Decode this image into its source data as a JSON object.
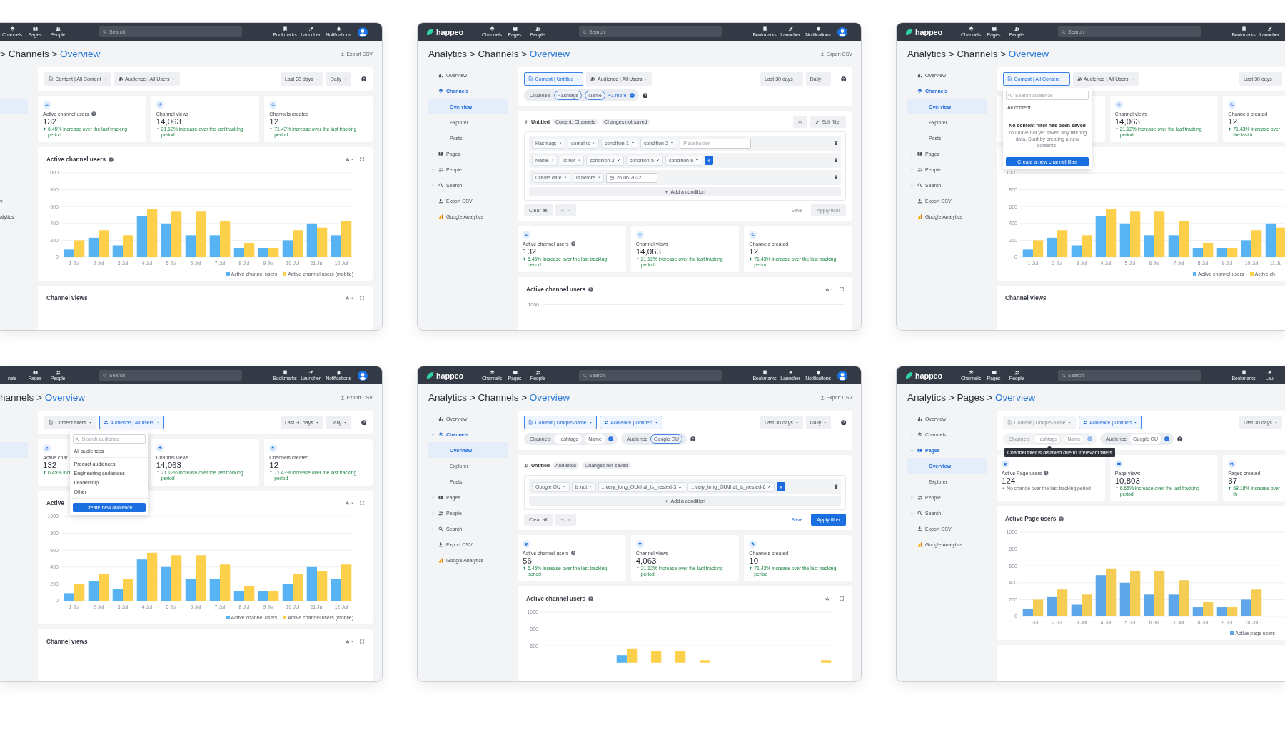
{
  "windows": [
    {
      "topbar": {
        "nav": [
          {
            "kind": "channels",
            "label": "Channels"
          },
          {
            "kind": "pages",
            "label": "Pages"
          },
          {
            "kind": "people",
            "label": "People"
          }
        ],
        "search": {
          "placeholder": "Search"
        },
        "actions": [
          {
            "kind": "bookmarks",
            "label": "Bookmarks"
          },
          {
            "kind": "launcher",
            "label": "Launcher"
          },
          {
            "kind": "notifications",
            "label": "Notifications"
          }
        ],
        "avatar": true
      },
      "breadcrumb": {
        "path": "> Channels > ",
        "current": "Overview"
      },
      "export": "Export CSV",
      "sidebar": {
        "kind": "fragment",
        "selected": true,
        "texts": [
          "y",
          "alytics"
        ]
      },
      "filters": {
        "buttons": [
          {
            "kind": "content",
            "label": "Content | All Content",
            "active": false
          },
          {
            "kind": "audience",
            "label": "Audience | All Users",
            "active": false
          }
        ],
        "period": "Last 30 days",
        "interval": "Daily",
        "help": true
      },
      "stats": [
        {
          "kind": "users",
          "label": "Active channel users",
          "help": true,
          "value": "132",
          "change": "6.45% increase over the last tracking period",
          "up": true
        },
        {
          "kind": "views",
          "label": "Channel views",
          "value": "14,063",
          "change": "21.12% increase over the last tracking period",
          "up": true
        },
        {
          "kind": "created",
          "label": "Channels created",
          "value": "12",
          "change": "71.43% increase over the last tracking period",
          "up": true
        }
      ],
      "charts": [
        {
          "title": "Active channel users",
          "help": true,
          "tools": true,
          "chart_data": {
            "type": "bar",
            "grid": true,
            "legend": "bottom-right",
            "categories": [
              "1 Jul",
              "2 Jul",
              "3 Jul",
              "4 Jul",
              "5 Jul",
              "6 Jul",
              "7 Jul",
              "8 Jul",
              "9 Jul",
              "10 Jul",
              "11 Jul",
              "12 Jul"
            ],
            "ylim": [
              0,
              1000
            ],
            "yticks": [
              0,
              200,
              400,
              600,
              800,
              1000
            ],
            "series": [
              {
                "name": "Active channel users",
                "color": "#57b3f2",
                "values": [
                  90,
                  230,
                  140,
                  490,
                  400,
                  260,
                  260,
                  110,
                  110,
                  200,
                  400,
                  260
                ]
              },
              {
                "name": "Active channel users (mobile)",
                "color": "#fdd04c",
                "values": [
                  200,
                  320,
                  260,
                  570,
                  540,
                  540,
                  430,
                  170,
                  110,
                  320,
                  350,
                  430
                ]
              }
            ]
          }
        },
        {
          "title": "Channel views",
          "tools": true
        }
      ]
    },
    {
      "topbar": {
        "logo": "happeo",
        "nav": [
          {
            "kind": "channels",
            "label": "Channels"
          },
          {
            "kind": "pages",
            "label": "Pages"
          },
          {
            "kind": "people",
            "label": "People"
          }
        ],
        "search": {
          "placeholder": "Search"
        },
        "actions": [
          {
            "kind": "bookmarks",
            "label": "Bookmarks"
          },
          {
            "kind": "launcher",
            "label": "Launcher"
          },
          {
            "kind": "notifications",
            "label": "Notifications"
          }
        ],
        "avatar": true
      },
      "breadcrumb": {
        "path": "Analytics > Channels > ",
        "current": "Overview"
      },
      "export": "Export CSV",
      "sidebar": {
        "kind": "tree",
        "items": [
          {
            "kind": "overview",
            "label": "Overview",
            "selected": false
          },
          {
            "kind": "channels",
            "label": "Channels",
            "selected": false,
            "expanded": true,
            "children": [
              {
                "label": "Overview",
                "selected": true
              },
              {
                "label": "Explorer",
                "selected": false
              },
              {
                "label": "Posts",
                "selected": false
              }
            ]
          },
          {
            "kind": "pages",
            "label": "Pages",
            "selected": false,
            "expanded": false
          },
          {
            "kind": "people",
            "label": "People",
            "selected": false,
            "expanded": false
          },
          {
            "kind": "search",
            "label": "Search",
            "selected": false,
            "expanded": false
          },
          {
            "kind": "export",
            "label": "Export CSV",
            "selected": false
          },
          {
            "kind": "analytics",
            "label": "Google Analytics",
            "selected": false
          }
        ]
      },
      "filters": {
        "buttons": [
          {
            "kind": "content",
            "label": "Content | Untitled",
            "active": true
          },
          {
            "kind": "audience",
            "label": "Audience | All Users",
            "active": false
          }
        ],
        "period": "Last 30 days",
        "interval": "Daily",
        "help": true,
        "chip_groups": [
          {
            "label": "Channels",
            "chips": [
              {
                "label": "Hashtags",
                "selected": true
              },
              {
                "label": "Name",
                "selected": true
              }
            ],
            "more": "+1 more",
            "checked": true,
            "disabled": false
          }
        ],
        "chips_help": true
      },
      "editor": {
        "kind": "content",
        "title": "Untitled",
        "tags": [
          "Conent: Channels",
          "Changes not saved"
        ],
        "link": true,
        "edit": "Edit filter",
        "conditions": [
          {
            "field": "Hashtags",
            "operator": "contains",
            "values": [
              "condition-1",
              "condition-2"
            ],
            "placeholder": "Placeholder"
          },
          {
            "field": "Name",
            "operator": "is not",
            "values": [
              "condition-2",
              "condition-5",
              "condition-6"
            ],
            "add": true
          },
          {
            "field": "Create date",
            "operator": "is before",
            "date": "26.06.2022"
          }
        ],
        "add_condition": "Add a condition",
        "clear": "Clear all",
        "undo": true,
        "save": "Save",
        "apply": "Apply filter",
        "enabled": false
      },
      "stats": [
        {
          "kind": "users",
          "label": "Active channel users",
          "help": true,
          "value": "132",
          "change": "6.45% increase over the last tracking period",
          "up": true
        },
        {
          "kind": "views",
          "label": "Channel views",
          "value": "14,063",
          "change": "21.12% increase over the last tracking period",
          "up": true
        },
        {
          "kind": "created",
          "label": "Channels created",
          "value": "12",
          "change": "71.43% increase over the last tracking period",
          "up": true
        }
      ],
      "charts": [
        {
          "title": "Active channel users",
          "help": true,
          "tools": true,
          "ticks": [
            "1000"
          ]
        }
      ]
    },
    {
      "topbar": {
        "logo": "happeo",
        "nav": [
          {
            "kind": "channels",
            "label": "Channels"
          },
          {
            "kind": "pages",
            "label": "Pages"
          },
          {
            "kind": "people",
            "label": "People"
          }
        ],
        "search": {
          "placeholder": "Search"
        },
        "actions": [
          {
            "kind": "bookmarks",
            "label": "Bookmarks"
          },
          {
            "kind": "launcher",
            "label": "Launcher"
          }
        ]
      },
      "breadcrumb": {
        "path": "Analytics > Channels > ",
        "current": "Overview"
      },
      "sidebar": {
        "kind": "tree",
        "items": [
          {
            "kind": "overview",
            "label": "Overview",
            "selected": false
          },
          {
            "kind": "channels",
            "label": "Channels",
            "selected": false,
            "expanded": true,
            "children": [
              {
                "label": "Overview",
                "selected": true
              },
              {
                "label": "Explorer",
                "selected": false
              },
              {
                "label": "Posts",
                "selected": false
              }
            ]
          },
          {
            "kind": "pages",
            "label": "Pages",
            "selected": false,
            "expanded": false
          },
          {
            "kind": "people",
            "label": "People",
            "selected": false,
            "expanded": false
          },
          {
            "kind": "search",
            "label": "Search",
            "selected": false,
            "expanded": false
          },
          {
            "kind": "export",
            "label": "Export CSV",
            "selected": false
          },
          {
            "kind": "analytics",
            "label": "Google Analytics",
            "selected": false
          }
        ]
      },
      "filters": {
        "buttons": [
          {
            "kind": "content",
            "label": "Content | All Content",
            "active": true,
            "menu": {
              "search": {
                "placeholder": "Search audience"
              },
              "items": [
                "All content"
              ],
              "empty": {
                "title": "No content filter has been saved",
                "text": "You have not yet saved any filtering data. Start by creating a new contents."
              },
              "button": "Create a new channel filter"
            }
          },
          {
            "kind": "audience",
            "label": "Audience | All Users",
            "active": false
          }
        ],
        "period": "Last 30 days"
      },
      "stats": [
        {
          "kind": "blank"
        },
        {
          "kind": "views",
          "label": "Channel views",
          "value": "14,063",
          "change": "21.12% increase over the last tracking period",
          "up": true
        },
        {
          "kind": "created",
          "label": "Channels created",
          "value": "12",
          "change": "71.43% increase over the last tr",
          "up": true
        }
      ],
      "charts": [
        {
          "chart_data": {
            "type": "bar",
            "grid": true,
            "legend": "bottom-right",
            "categories": [
              "1 Jul",
              "2 Jul",
              "3 Jul",
              "4 Jul",
              "5 Jul",
              "6 Jul",
              "7 Jul",
              "8 Jul",
              "9 Jul",
              "10 Jul",
              "11 Ju"
            ],
            "ylim": [
              0,
              1000
            ],
            "yticks": [
              0,
              200,
              400,
              600,
              800,
              1000
            ],
            "series": [
              {
                "name": "Active channel users",
                "color": "#57b3f2",
                "values": [
                  90,
                  230,
                  140,
                  490,
                  400,
                  260,
                  260,
                  110,
                  110,
                  200,
                  400
                ]
              },
              {
                "name": "Active ch",
                "color": "#fdd04c",
                "values": [
                  200,
                  320,
                  260,
                  570,
                  540,
                  540,
                  430,
                  170,
                  110,
                  320,
                  350
                ]
              }
            ]
          }
        },
        {
          "title": "Channel views"
        }
      ]
    },
    {
      "topbar": {
        "nav": [
          {
            "label": "nels",
            "partial": true
          },
          {
            "kind": "pages",
            "label": "Pages"
          },
          {
            "kind": "people",
            "label": "People"
          }
        ],
        "search": {
          "placeholder": "Search"
        },
        "actions": [
          {
            "kind": "bookmarks",
            "label": "Bookmarks"
          },
          {
            "kind": "launcher",
            "label": "Launcher"
          },
          {
            "kind": "notifications",
            "label": "Notifications"
          }
        ],
        "avatar": true
      },
      "breadcrumb": {
        "path": "hannels > ",
        "current": "Overview"
      },
      "export": "Export CSV",
      "sidebar": {
        "kind": "fragment",
        "selected": true
      },
      "filters": {
        "buttons": [
          {
            "kind": "content",
            "label": "Content filters",
            "active": false
          },
          {
            "kind": "audience",
            "label": "Audience | All users",
            "active": true,
            "menu": {
              "search": {
                "placeholder": "Search audience"
              },
              "items": [
                "All audiences"
              ],
              "options": [
                "Product audiences",
                "Engineering audiences",
                "Leadership",
                "Other"
              ],
              "button": "Create new audience"
            }
          }
        ],
        "period": "Last 30 days",
        "interval": "Daily",
        "help": true
      },
      "stats": [
        {
          "kind": "users",
          "label": "Active char",
          "value": "132",
          "change": "6.45% incr",
          "up": true
        },
        {
          "kind": "views",
          "label": "Channel views",
          "value": "14,063",
          "change": "21.12% increase over the last tracking period",
          "up": true
        },
        {
          "kind": "created",
          "label": "Channels created",
          "value": "12",
          "change": "71.43% increase over the last tracking period",
          "up": true
        }
      ],
      "charts": [
        {
          "title": "Active",
          "tools": true,
          "chart_data": {
            "type": "bar",
            "grid": true,
            "legend": "bottom-right",
            "categories": [
              "1 Jul",
              "2 Jul",
              "3 Jul",
              "4 Jul",
              "5 Jul",
              "6 Jul",
              "7 Jul",
              "8 Jul",
              "9 Jul",
              "10 Jul",
              "11 Jul",
              "12 Jul"
            ],
            "ylim": [
              0,
              1000
            ],
            "yticks": [
              0,
              200,
              400,
              600,
              800,
              1000
            ],
            "series": [
              {
                "name": "Active channel users",
                "color": "#57b3f2",
                "values": [
                  90,
                  230,
                  140,
                  490,
                  400,
                  260,
                  260,
                  110,
                  110,
                  200,
                  400,
                  260
                ]
              },
              {
                "name": "Active channel users (mobile)",
                "color": "#fdd04c",
                "values": [
                  200,
                  320,
                  260,
                  570,
                  540,
                  540,
                  430,
                  170,
                  110,
                  320,
                  350,
                  430
                ]
              }
            ]
          }
        },
        {
          "title": "Channel views",
          "tools": true
        }
      ]
    },
    {
      "topbar": {
        "logo": "happeo",
        "nav": [
          {
            "kind": "channels",
            "label": "Channels"
          },
          {
            "kind": "pages",
            "label": "Pages"
          },
          {
            "kind": "people",
            "label": "People"
          }
        ],
        "search": {
          "placeholder": "Search"
        },
        "actions": [
          {
            "kind": "bookmarks",
            "label": "Bookmarks"
          },
          {
            "kind": "launcher",
            "label": "Launcher"
          },
          {
            "kind": "notifications",
            "label": "Notifications"
          }
        ],
        "avatar": true
      },
      "breadcrumb": {
        "path": "Analytics > Channels > ",
        "current": "Overview"
      },
      "export": "Export CSV",
      "sidebar": {
        "kind": "tree",
        "items": [
          {
            "kind": "overview",
            "label": "Overview",
            "selected": false
          },
          {
            "kind": "channels",
            "label": "Channels",
            "selected": false,
            "expanded": true,
            "children": [
              {
                "label": "Overview",
                "selected": true
              },
              {
                "label": "Explorer",
                "selected": false
              },
              {
                "label": "Posts",
                "selected": false
              }
            ]
          },
          {
            "kind": "pages",
            "label": "Pages",
            "selected": false,
            "expanded": false
          },
          {
            "kind": "people",
            "label": "People",
            "selected": false,
            "expanded": false
          },
          {
            "kind": "search",
            "label": "Search",
            "selected": false,
            "expanded": false
          },
          {
            "kind": "export",
            "label": "Export CSV",
            "selected": false
          },
          {
            "kind": "analytics",
            "label": "Google Analytics",
            "selected": false
          }
        ]
      },
      "filters": {
        "buttons": [
          {
            "kind": "content",
            "label": "Content | Unique-name",
            "active": true
          },
          {
            "kind": "audience",
            "label": "Audience | Untitled",
            "active": true
          }
        ],
        "period": "Last 30 days",
        "interval": "Daily",
        "help": true,
        "chip_groups": [
          {
            "label": "Channels",
            "chips": [
              {
                "label": "Hashtags",
                "selected": false
              },
              {
                "label": "Name",
                "selected": false
              }
            ],
            "checked": true,
            "disabled": false
          },
          {
            "label": "Audience",
            "chips": [
              {
                "label": "Google OU",
                "selected": true
              }
            ],
            "checked": false,
            "disabled": false
          }
        ],
        "chips_help": true
      },
      "editor": {
        "kind": "audience",
        "title": "Untitled",
        "tags": [
          "Audience",
          "Changes not saved"
        ],
        "conditions": [
          {
            "field": "Google OU",
            "operator": "is not",
            "values": [
              "...very_long_OU\\that_is_nested-3",
              "...very_long_OU\\that_is_nested-6"
            ],
            "add": true
          }
        ],
        "add_condition": "Add a condition",
        "clear": "Clear all",
        "undo": true,
        "save": "Save",
        "apply": "Apply filter",
        "enabled": true
      },
      "stats": [
        {
          "kind": "users",
          "label": "Active channel users",
          "help": true,
          "value": "56",
          "change": "6.45% increase over the last tracking period",
          "up": true
        },
        {
          "kind": "views",
          "label": "Channel views",
          "value": "4,063",
          "change": "21.12% increase over the last tracking period",
          "up": true
        },
        {
          "kind": "created",
          "label": "Channels created",
          "value": "10",
          "change": "71.43% increase over the last tracking period",
          "up": true
        }
      ],
      "charts": [
        {
          "title": "Active channel users",
          "help": true,
          "tools": true,
          "chart_data": {
            "type": "bar",
            "grid": true,
            "ylim": [
              400,
              1000
            ],
            "yticks": [
              600,
              800,
              1000
            ],
            "series": [
              {
                "color": "#57b3f2",
                "values": [
                  null,
                  null,
                  null,
                  490,
                  null,
                  null,
                  null,
                  null,
                  null,
                  null,
                  null,
                  null
                ]
              },
              {
                "color": "#fdd04c",
                "values": [
                  null,
                  null,
                  null,
                  570,
                  540,
                  540,
                  430,
                  null,
                  null,
                  null,
                  null,
                  430
                ]
              }
            ]
          }
        }
      ]
    },
    {
      "topbar": {
        "logo": "happeo",
        "nav": [
          {
            "kind": "channels",
            "label": "Channels"
          },
          {
            "kind": "pages",
            "label": "Pages"
          },
          {
            "kind": "people",
            "label": "People"
          }
        ],
        "search": {
          "placeholder": "Search"
        },
        "actions": [
          {
            "kind": "bookmarks",
            "label": "Bookmarks"
          },
          {
            "kind": "launcher",
            "label": "Lau"
          }
        ]
      },
      "breadcrumb": {
        "path": "Analytics > Pages > ",
        "current": "Overview"
      },
      "sidebar": {
        "kind": "tree",
        "items": [
          {
            "kind": "overview",
            "label": "Overview",
            "selected": false
          },
          {
            "kind": "channels",
            "label": "Channels",
            "selected": false,
            "expanded": false
          },
          {
            "kind": "pages",
            "label": "Pages",
            "selected": false,
            "expanded": true,
            "children": [
              {
                "label": "Overview",
                "selected": true
              },
              {
                "label": "Explorer",
                "selected": false
              }
            ]
          },
          {
            "kind": "people",
            "label": "People",
            "selected": false,
            "expanded": false
          },
          {
            "kind": "search",
            "label": "Search",
            "selected": false,
            "expanded": false
          },
          {
            "kind": "export",
            "label": "Export CSV",
            "selected": false
          },
          {
            "kind": "analytics",
            "label": "Google Analytics",
            "selected": false
          }
        ]
      },
      "filters": {
        "buttons": [
          {
            "kind": "content",
            "label": "Content | Unique-name",
            "active": false,
            "disabled": true
          },
          {
            "kind": "audience",
            "label": "Audience | Untitled",
            "active": true,
            "disabled": false
          }
        ],
        "period": "Last 30 days",
        "chip_groups": [
          {
            "label": "Channels",
            "chips": [
              {
                "label": "Hashtags",
                "selected": false
              },
              {
                "label": "Name",
                "selected": false
              }
            ],
            "checked": true,
            "disabled": true
          },
          {
            "label": "Audience",
            "chips": [
              {
                "label": "Google OU",
                "selected": false
              }
            ],
            "checked": true,
            "disabled": false
          }
        ],
        "chips_help": true,
        "tooltip": "Channel filter is disabled due to irrelevant filters"
      },
      "stats": [
        {
          "kind": "users",
          "label": "Active Page users",
          "help": true,
          "value": "124",
          "change": "No change over the last tracking period",
          "up": false
        },
        {
          "kind": "pages",
          "label": "Page views",
          "value": "10,803",
          "change": "6.65% increase over the last tracking period",
          "up": true
        },
        {
          "kind": "pages_created",
          "label": "Pages created",
          "value": "37",
          "change": "68.18% increase over th",
          "up": true
        }
      ],
      "charts": [
        {
          "title": "Active Page users",
          "help": true,
          "chart_data": {
            "type": "bar",
            "grid": true,
            "legend": "bottom-right",
            "categories": [
              "1 Jul",
              "2 Jul",
              "3 Jul",
              "4 Jul",
              "5 Jul",
              "6 Jul",
              "7 Jul",
              "8 Jul",
              "9 Jul",
              "10 Jul"
            ],
            "ylim": [
              0,
              1000
            ],
            "yticks": [
              0,
              200,
              400,
              600,
              800,
              1000
            ],
            "series": [
              {
                "name": "Active page users",
                "color": "#5ea8ea",
                "values": [
                  90,
                  230,
                  140,
                  490,
                  400,
                  260,
                  260,
                  110,
                  110,
                  200
                ]
              },
              {
                "color": "#f5cd55",
                "values": [
                  200,
                  320,
                  260,
                  570,
                  540,
                  540,
                  430,
                  170,
                  110,
                  320
                ]
              }
            ]
          }
        },
        {
          "blank": true
        }
      ]
    }
  ]
}
